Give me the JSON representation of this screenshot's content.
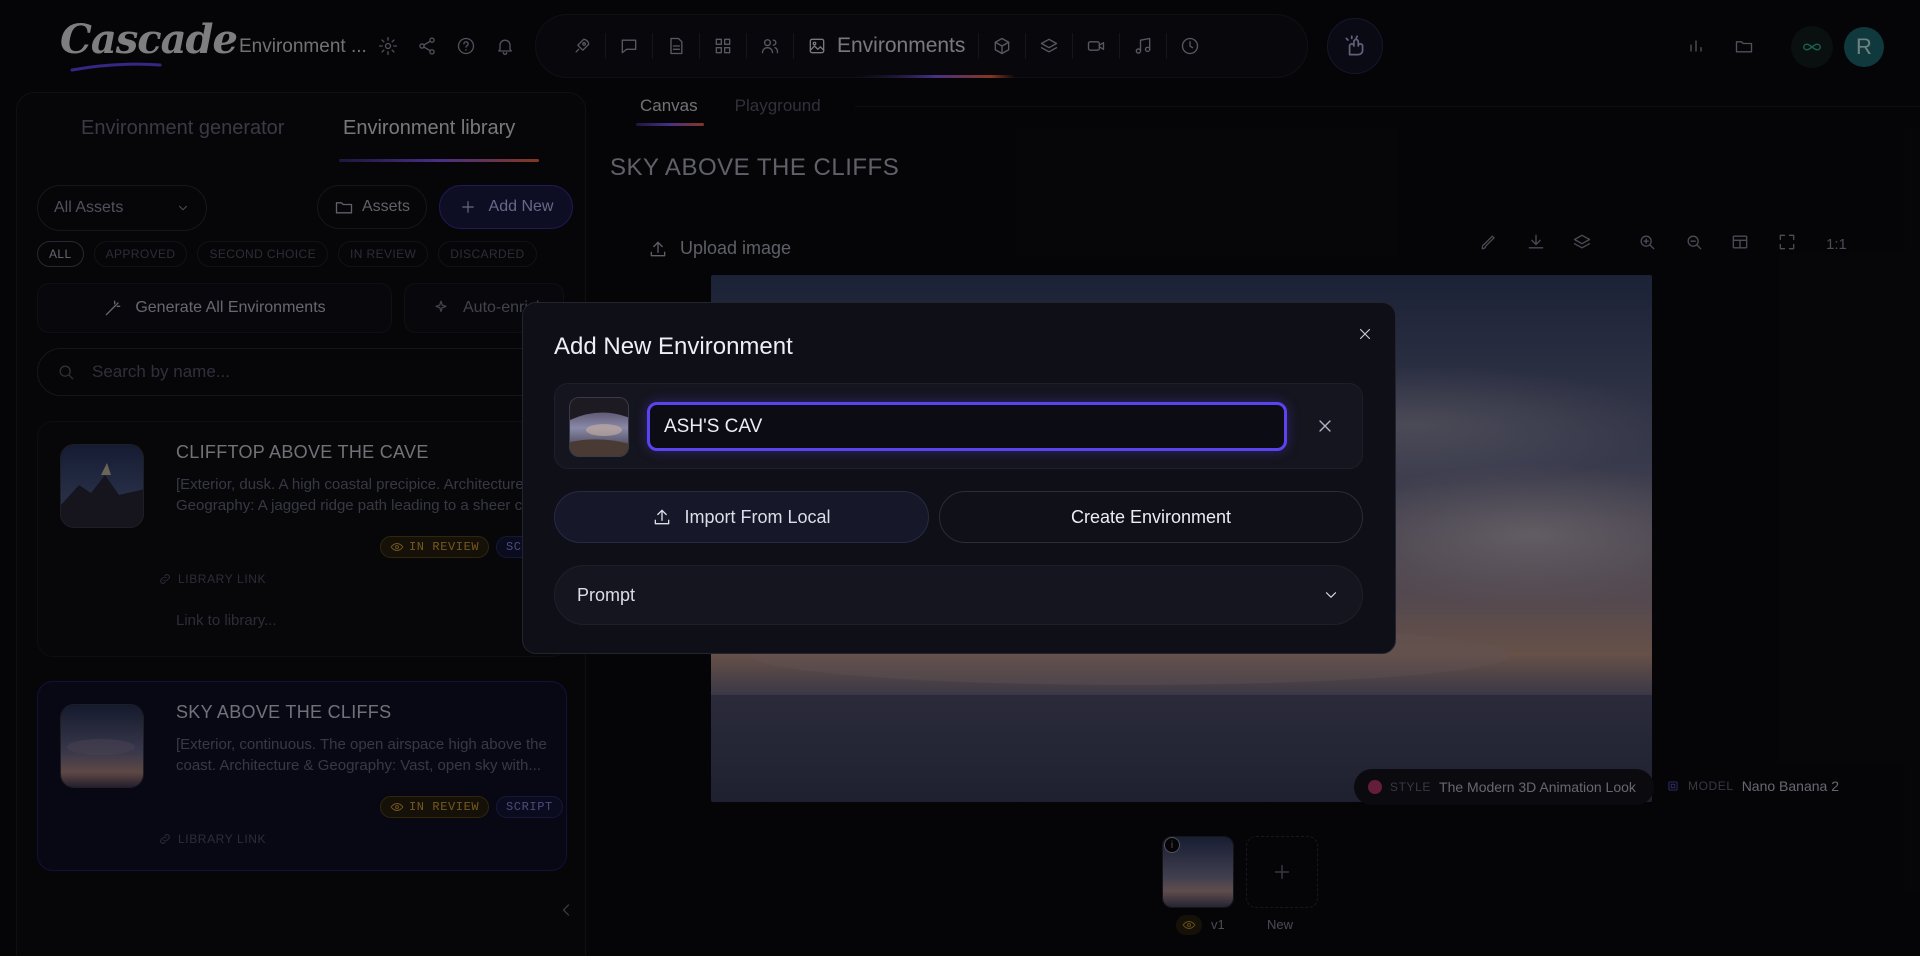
{
  "app": {
    "logo_text": "Cascade",
    "project_name": "Environment ...",
    "user_initial": "R"
  },
  "nav": {
    "current_section": "Environments",
    "glow_color": "#8a5cff"
  },
  "left_panel": {
    "tabs": [
      {
        "label": "Environment generator"
      },
      {
        "label": "Environment library"
      }
    ],
    "asset_filter": "All Assets",
    "assets_button": "Assets",
    "add_new_button": "Add New",
    "filter_chips": [
      "ALL",
      "APPROVED",
      "SECOND CHOICE",
      "IN REVIEW",
      "DISCARDED"
    ],
    "generate_all": "Generate All Environments",
    "auto_enrich": "Auto-enrich",
    "search_placeholder": "Search by name...",
    "cards": [
      {
        "title": "CLIFFTOP ABOVE THE CAVE",
        "desc_line1": "[Exterior, dusk. A high coastal precipice. Architecture &",
        "desc_line2": "Geography: A jagged ridge path leading to a sheer cliff",
        "status": "IN REVIEW",
        "tag": "SCRIPT",
        "library_link_label": "LIBRARY LINK",
        "link_placeholder": "Link to library..."
      },
      {
        "title": "SKY ABOVE THE CLIFFS",
        "desc_line1": "[Exterior, continuous. The open airspace high above the",
        "desc_line2": "coast. Architecture & Geography: Vast, open sky with...",
        "status": "IN REVIEW",
        "tag": "SCRIPT",
        "library_link_label": "LIBRARY LINK"
      }
    ]
  },
  "canvas": {
    "tabs": [
      {
        "label": "Canvas"
      },
      {
        "label": "Playground"
      }
    ],
    "scene_title": "SKY ABOVE THE CLIFFS",
    "upload_label": "Upload image",
    "zoom_label": "1:1",
    "style_key": "STYLE",
    "style_value": "The Modern 3D Animation Look",
    "model_key": "MODEL",
    "model_value": "Nano Banana 2",
    "versions": [
      {
        "label": "v1"
      }
    ],
    "new_version_label": "New"
  },
  "modal": {
    "title": "Add New Environment",
    "name_value": "ASH'S CAV",
    "import_button": "Import From Local",
    "create_button": "Create Environment",
    "prompt_label": "Prompt"
  },
  "colors": {
    "accent": "#5a44f0",
    "review": "#e0a83a",
    "script": "#8f93e8",
    "brand_teal": "#1f6e78"
  }
}
